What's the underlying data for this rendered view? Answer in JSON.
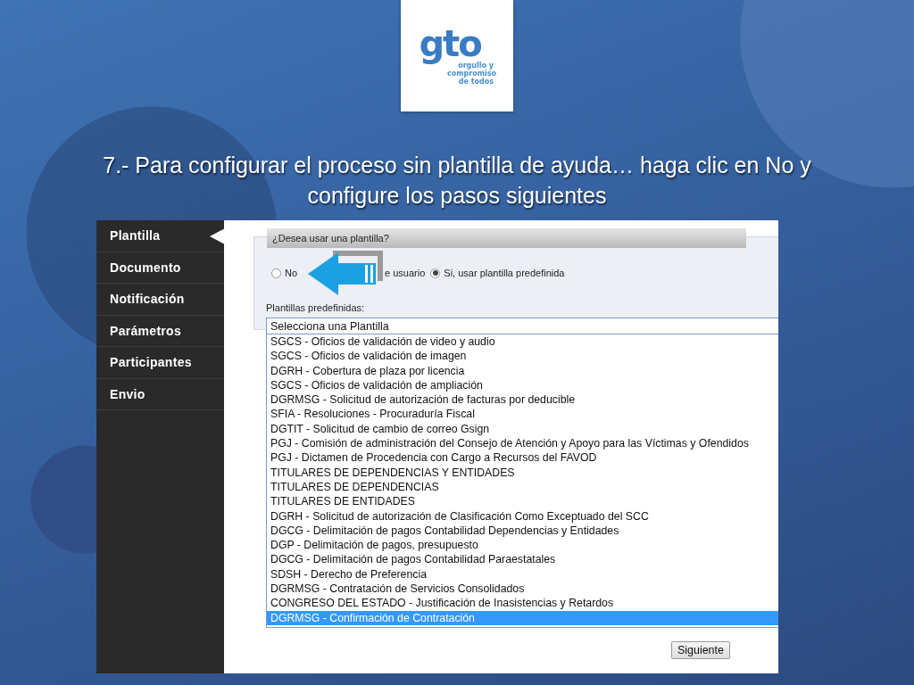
{
  "logo": {
    "mark": "gto",
    "tagline": "orgullo y compromiso de todos"
  },
  "title": "7.- Para configurar el proceso sin plantilla de ayuda… haga clic en No y configure los pasos siguientes",
  "sidebar": {
    "items": [
      {
        "label": "Plantilla",
        "selected": true
      },
      {
        "label": "Documento",
        "selected": false
      },
      {
        "label": "Notificación",
        "selected": false
      },
      {
        "label": "Parámetros",
        "selected": false
      },
      {
        "label": "Participantes",
        "selected": false
      },
      {
        "label": "Envio",
        "selected": false
      }
    ]
  },
  "form": {
    "legend": "¿Desea usar una plantilla?",
    "radios": [
      {
        "label": "No",
        "selected": false,
        "kind": "radio"
      },
      {
        "label": "e usuario",
        "kind": "partial"
      },
      {
        "label": "Si, usar plantilla predefinida",
        "selected": true,
        "kind": "radio"
      }
    ],
    "select_label": "Plantillas predefinidas:",
    "select": {
      "value": "Selecciona una Plantilla",
      "expanded": true,
      "options": [
        {
          "label": "SGCS - Oficios de validación de video y audio",
          "selected": false
        },
        {
          "label": "SGCS - Oficios de validación de imagen",
          "selected": false
        },
        {
          "label": "DGRH - Cobertura de plaza por licencia",
          "selected": false
        },
        {
          "label": "SGCS - Oficios de validación de ampliación",
          "selected": false
        },
        {
          "label": "DGRMSG - Solicitud de autorización de facturas por deducible",
          "selected": false
        },
        {
          "label": "SFIA - Resoluciones - Procuraduría Fiscal",
          "selected": false
        },
        {
          "label": "DGTIT - Solicitud de cambio de correo Gsign",
          "selected": false
        },
        {
          "label": "PGJ - Comisión de administración del Consejo de Atención y Apoyo para las Víctimas y Ofendidos",
          "selected": false
        },
        {
          "label": "PGJ - Dictamen de Procedencia con Cargo a Recursos del FAVOD",
          "selected": false
        },
        {
          "label": "TITULARES DE DEPENDENCIAS Y ENTIDADES",
          "selected": false
        },
        {
          "label": "TITULARES DE DEPENDENCIAS",
          "selected": false
        },
        {
          "label": "TITULARES DE ENTIDADES",
          "selected": false
        },
        {
          "label": "DGRH - Solicitud de autorización de Clasificación Como Exceptuado del SCC",
          "selected": false
        },
        {
          "label": "DGCG - Delimitación de pagos Contabilidad Dependencias y Entidades",
          "selected": false
        },
        {
          "label": "DGP - Delimitación de pagos, presupuesto",
          "selected": false
        },
        {
          "label": "DGCG - Delimitación de pagos Contabilidad Paraestatales",
          "selected": false
        },
        {
          "label": "SDSH - Derecho de Preferencia",
          "selected": false
        },
        {
          "label": "DGRMSG - Contratación de Servicios Consolidados",
          "selected": false
        },
        {
          "label": "CONGRESO DEL ESTADO - Justificación de Inasistencias y Retardos",
          "selected": false
        },
        {
          "label": "DGRMSG - Confirmación de Contratación",
          "selected": true
        }
      ]
    },
    "next_button": "Siguiente"
  }
}
